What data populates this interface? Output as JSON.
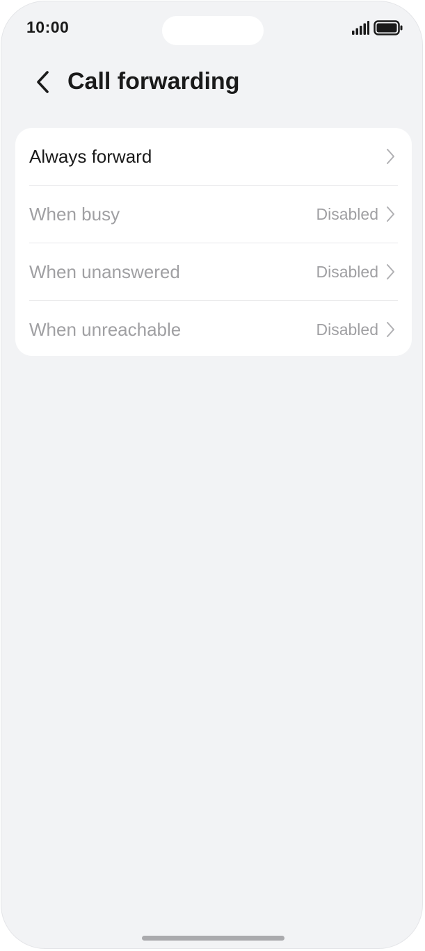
{
  "status_bar": {
    "time": "10:00",
    "signal_icon": "signal-bars-icon",
    "battery_icon": "battery-full-icon"
  },
  "nav": {
    "back_icon": "chevron-left-icon",
    "title": "Call forwarding"
  },
  "options": [
    {
      "label": "Always forward",
      "value": "",
      "enabled": true
    },
    {
      "label": "When busy",
      "value": "Disabled",
      "enabled": false
    },
    {
      "label": "When unanswered",
      "value": "Disabled",
      "enabled": false
    },
    {
      "label": "When unreachable",
      "value": "Disabled",
      "enabled": false
    }
  ],
  "colors": {
    "background": "#f2f3f5",
    "card": "#ffffff",
    "text_primary": "#1a1a1a",
    "text_disabled": "#a0a0a3"
  }
}
